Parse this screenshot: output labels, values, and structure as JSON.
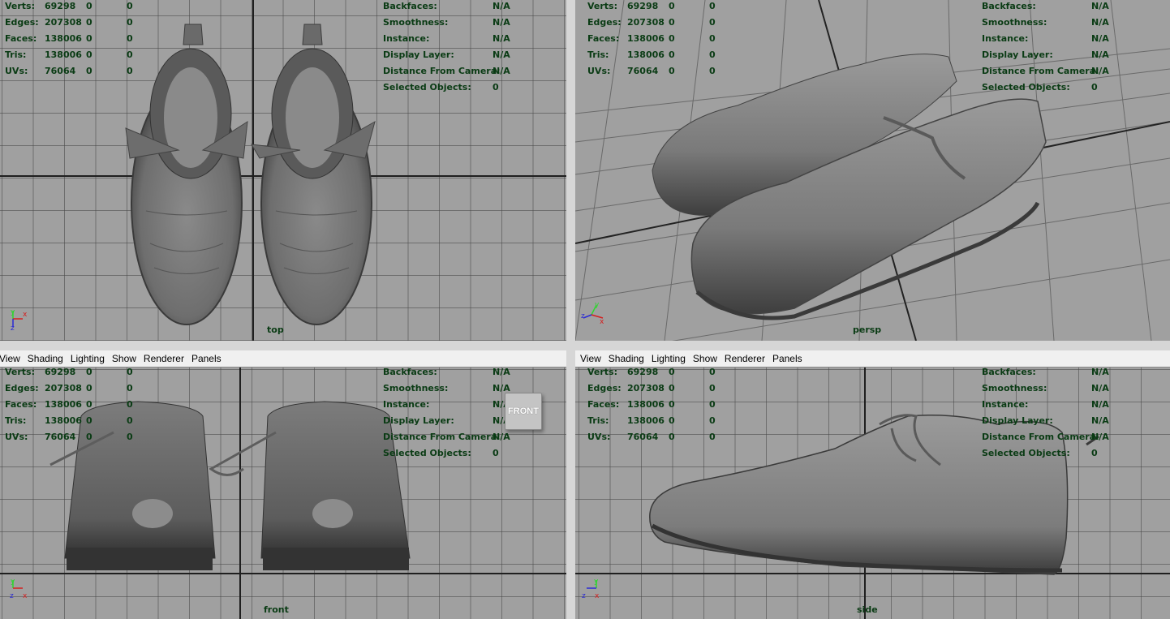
{
  "menu": [
    "View",
    "Shading",
    "Lighting",
    "Show",
    "Renderer",
    "Panels"
  ],
  "stats_labels": [
    "Verts:",
    "Edges:",
    "Faces:",
    "Tris:",
    "UVs:"
  ],
  "stats_rows": [
    {
      "label": "Verts:",
      "a": "69298",
      "b": "0",
      "c": "0"
    },
    {
      "label": "Edges:",
      "a": "207308",
      "b": "0",
      "c": "0"
    },
    {
      "label": "Faces:",
      "a": "138006",
      "b": "0",
      "c": "0"
    },
    {
      "label": "Tris:",
      "a": "138006",
      "b": "0",
      "c": "0"
    },
    {
      "label": "UVs:",
      "a": "76064",
      "b": "0",
      "c": "0"
    }
  ],
  "info_rows": [
    {
      "label": "Backfaces:",
      "value": "N/A"
    },
    {
      "label": "Smoothness:",
      "value": "N/A"
    },
    {
      "label": "Instance:",
      "value": "N/A"
    },
    {
      "label": "Display Layer:",
      "value": "N/A"
    },
    {
      "label": "Distance From Camera:",
      "value": "N/A"
    },
    {
      "label": "Selected Objects:",
      "value": "0"
    }
  ],
  "viewports": {
    "top": {
      "camera": "top"
    },
    "persp": {
      "camera": "persp"
    },
    "front": {
      "camera": "front",
      "view_cube": "FRONT"
    },
    "side": {
      "camera": "side"
    }
  },
  "colors": {
    "viewport_bg": "#a0a0a0",
    "hud_text": "#0a3b14",
    "axis_x": "#d41f1f",
    "axis_y": "#2fd42f",
    "axis_z": "#2b2bd4",
    "menubar_bg": "#f0f0f0"
  }
}
